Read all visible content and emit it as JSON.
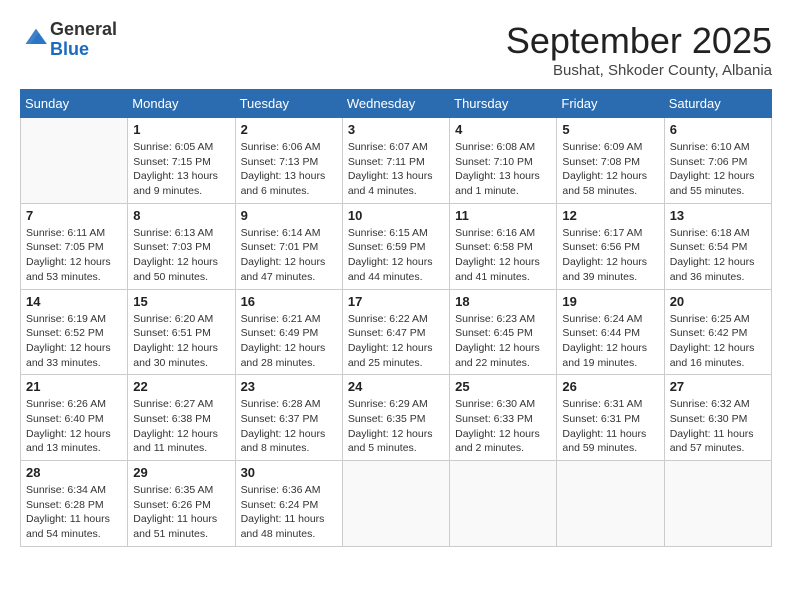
{
  "header": {
    "logo_line1": "General",
    "logo_line2": "Blue",
    "month_title": "September 2025",
    "subtitle": "Bushat, Shkoder County, Albania"
  },
  "days_of_week": [
    "Sunday",
    "Monday",
    "Tuesday",
    "Wednesday",
    "Thursday",
    "Friday",
    "Saturday"
  ],
  "weeks": [
    [
      {
        "day": "",
        "info": ""
      },
      {
        "day": "1",
        "info": "Sunrise: 6:05 AM\nSunset: 7:15 PM\nDaylight: 13 hours\nand 9 minutes."
      },
      {
        "day": "2",
        "info": "Sunrise: 6:06 AM\nSunset: 7:13 PM\nDaylight: 13 hours\nand 6 minutes."
      },
      {
        "day": "3",
        "info": "Sunrise: 6:07 AM\nSunset: 7:11 PM\nDaylight: 13 hours\nand 4 minutes."
      },
      {
        "day": "4",
        "info": "Sunrise: 6:08 AM\nSunset: 7:10 PM\nDaylight: 13 hours\nand 1 minute."
      },
      {
        "day": "5",
        "info": "Sunrise: 6:09 AM\nSunset: 7:08 PM\nDaylight: 12 hours\nand 58 minutes."
      },
      {
        "day": "6",
        "info": "Sunrise: 6:10 AM\nSunset: 7:06 PM\nDaylight: 12 hours\nand 55 minutes."
      }
    ],
    [
      {
        "day": "7",
        "info": "Sunrise: 6:11 AM\nSunset: 7:05 PM\nDaylight: 12 hours\nand 53 minutes."
      },
      {
        "day": "8",
        "info": "Sunrise: 6:13 AM\nSunset: 7:03 PM\nDaylight: 12 hours\nand 50 minutes."
      },
      {
        "day": "9",
        "info": "Sunrise: 6:14 AM\nSunset: 7:01 PM\nDaylight: 12 hours\nand 47 minutes."
      },
      {
        "day": "10",
        "info": "Sunrise: 6:15 AM\nSunset: 6:59 PM\nDaylight: 12 hours\nand 44 minutes."
      },
      {
        "day": "11",
        "info": "Sunrise: 6:16 AM\nSunset: 6:58 PM\nDaylight: 12 hours\nand 41 minutes."
      },
      {
        "day": "12",
        "info": "Sunrise: 6:17 AM\nSunset: 6:56 PM\nDaylight: 12 hours\nand 39 minutes."
      },
      {
        "day": "13",
        "info": "Sunrise: 6:18 AM\nSunset: 6:54 PM\nDaylight: 12 hours\nand 36 minutes."
      }
    ],
    [
      {
        "day": "14",
        "info": "Sunrise: 6:19 AM\nSunset: 6:52 PM\nDaylight: 12 hours\nand 33 minutes."
      },
      {
        "day": "15",
        "info": "Sunrise: 6:20 AM\nSunset: 6:51 PM\nDaylight: 12 hours\nand 30 minutes."
      },
      {
        "day": "16",
        "info": "Sunrise: 6:21 AM\nSunset: 6:49 PM\nDaylight: 12 hours\nand 28 minutes."
      },
      {
        "day": "17",
        "info": "Sunrise: 6:22 AM\nSunset: 6:47 PM\nDaylight: 12 hours\nand 25 minutes."
      },
      {
        "day": "18",
        "info": "Sunrise: 6:23 AM\nSunset: 6:45 PM\nDaylight: 12 hours\nand 22 minutes."
      },
      {
        "day": "19",
        "info": "Sunrise: 6:24 AM\nSunset: 6:44 PM\nDaylight: 12 hours\nand 19 minutes."
      },
      {
        "day": "20",
        "info": "Sunrise: 6:25 AM\nSunset: 6:42 PM\nDaylight: 12 hours\nand 16 minutes."
      }
    ],
    [
      {
        "day": "21",
        "info": "Sunrise: 6:26 AM\nSunset: 6:40 PM\nDaylight: 12 hours\nand 13 minutes."
      },
      {
        "day": "22",
        "info": "Sunrise: 6:27 AM\nSunset: 6:38 PM\nDaylight: 12 hours\nand 11 minutes."
      },
      {
        "day": "23",
        "info": "Sunrise: 6:28 AM\nSunset: 6:37 PM\nDaylight: 12 hours\nand 8 minutes."
      },
      {
        "day": "24",
        "info": "Sunrise: 6:29 AM\nSunset: 6:35 PM\nDaylight: 12 hours\nand 5 minutes."
      },
      {
        "day": "25",
        "info": "Sunrise: 6:30 AM\nSunset: 6:33 PM\nDaylight: 12 hours\nand 2 minutes."
      },
      {
        "day": "26",
        "info": "Sunrise: 6:31 AM\nSunset: 6:31 PM\nDaylight: 11 hours\nand 59 minutes."
      },
      {
        "day": "27",
        "info": "Sunrise: 6:32 AM\nSunset: 6:30 PM\nDaylight: 11 hours\nand 57 minutes."
      }
    ],
    [
      {
        "day": "28",
        "info": "Sunrise: 6:34 AM\nSunset: 6:28 PM\nDaylight: 11 hours\nand 54 minutes."
      },
      {
        "day": "29",
        "info": "Sunrise: 6:35 AM\nSunset: 6:26 PM\nDaylight: 11 hours\nand 51 minutes."
      },
      {
        "day": "30",
        "info": "Sunrise: 6:36 AM\nSunset: 6:24 PM\nDaylight: 11 hours\nand 48 minutes."
      },
      {
        "day": "",
        "info": ""
      },
      {
        "day": "",
        "info": ""
      },
      {
        "day": "",
        "info": ""
      },
      {
        "day": "",
        "info": ""
      }
    ]
  ]
}
